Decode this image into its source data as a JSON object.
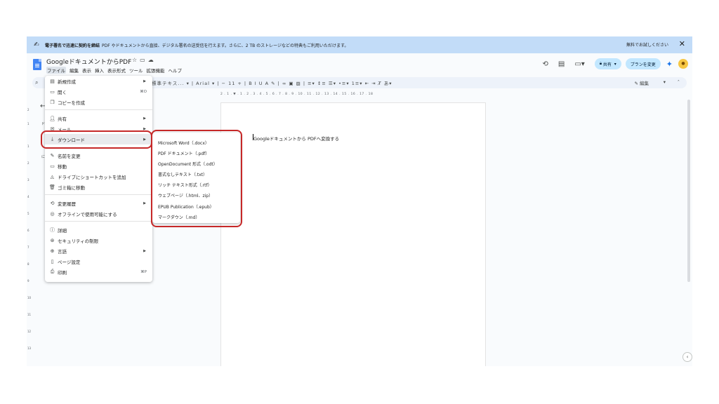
{
  "banner": {
    "bold_text": "電子署名で迅速に契約を締結",
    "text": "PDF やドキュメントから直接、デジタル署名の送受信を行えます。さらに、2 TB のストレージなどの特典もご利用いただけます。",
    "trial_link": "無料でお試しください"
  },
  "doc": {
    "title": "GoogleドキュメントからPDF",
    "body_text": "Googleドキュメントから PDFへ変換する"
  },
  "menubar": [
    "ファイル",
    "編集",
    "表示",
    "挿入",
    "表示形式",
    "ツール",
    "拡張機能",
    "ヘルプ"
  ],
  "header": {
    "share_label": "共有",
    "plan_label": "プランを変更"
  },
  "toolbar": {
    "style_label": "標準テキス...",
    "font_label": "Arial",
    "font_size": "11",
    "edit_label": "編集"
  },
  "ruler": "2 . 1 . ▼ . 1 . 2 . 3 . 4 . 5 . 6 . 7 . 8 . 9 . 10 . 11 . 12 . 13 . 14 . 15 . 16 . 17 . 18",
  "file_menu": {
    "new": "新規作成",
    "open": "開く",
    "open_shortcut": "⌘O",
    "copy": "コピーを作成",
    "share": "共有",
    "email": "メール",
    "download": "ダウンロード",
    "rename": "名前を変更",
    "move": "移動",
    "shortcut": "ドライブにショートカットを追加",
    "trash": "ゴミ箱に移動",
    "history": "変更履歴",
    "offline": "オフラインで使用可能にする",
    "details": "詳細",
    "security": "セキュリティの制限",
    "language": "言語",
    "page_setup": "ページ設定",
    "print": "印刷",
    "print_shortcut": "⌘P"
  },
  "download_menu": [
    "Microsoft Word（.docx）",
    "PDF ドキュメント（.pdf）",
    "OpenDocument 形式（.odt）",
    "書式なしテキスト（.txt）",
    "リッチ テキスト形式（.rtf）",
    "ウェブページ（.html、zip）",
    "EPUB Publication（.epub）",
    "マークダウン（.md）"
  ],
  "colors": {
    "banner": "#c2dcf8",
    "share": "#c2e7ff",
    "highlight": "#c62828"
  }
}
